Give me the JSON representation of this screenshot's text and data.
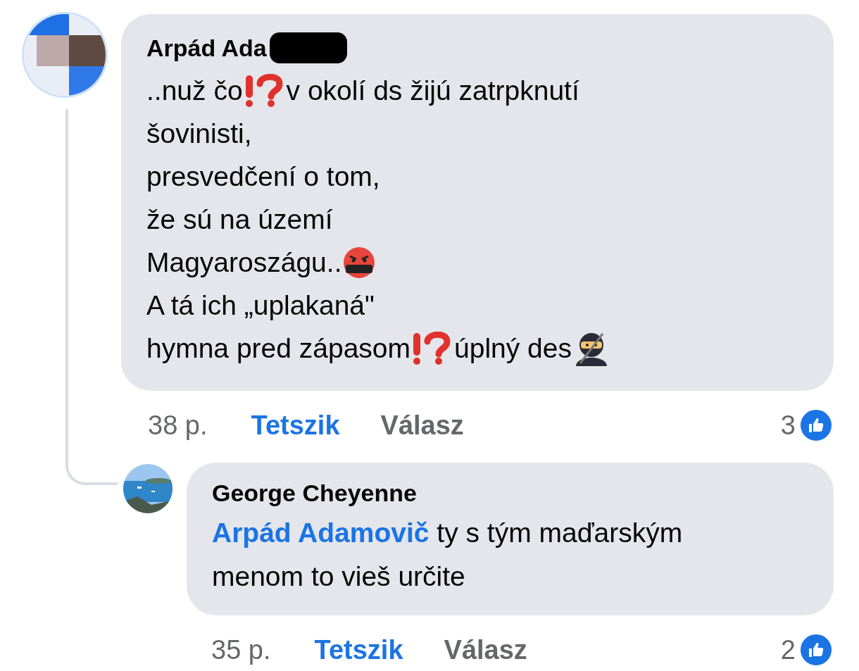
{
  "comments": [
    {
      "author": "Arpád Ada",
      "redacted": true,
      "lines": [
        [
          {
            "kind": "text",
            "text": "..nuž čo"
          },
          {
            "kind": "interrobang"
          },
          {
            "kind": "text",
            "text": "v okolí ds žijú zatrpknutí"
          }
        ],
        [
          {
            "kind": "text",
            "text": "šovinisti,"
          }
        ],
        [
          {
            "kind": "text",
            "text": "presvedčení o tom,"
          }
        ],
        [
          {
            "kind": "text",
            "text": "že sú na území"
          }
        ],
        [
          {
            "kind": "text",
            "text": "Magyaroszágu.."
          },
          {
            "kind": "swearing-face"
          }
        ],
        [
          {
            "kind": "text",
            "text": "A tá ich „uplakaná\""
          }
        ],
        [
          {
            "kind": "text",
            "text": "hymna pred zápasom"
          },
          {
            "kind": "interrobang"
          },
          {
            "kind": "text",
            "text": "úplný des"
          },
          {
            "kind": "ninja"
          }
        ]
      ],
      "time": "38 p.",
      "like_label": "Tetszik",
      "reply_label": "Válasz",
      "reaction_count": "3",
      "replies": [
        {
          "author": "George Cheyenne",
          "mention": "Arpád Adamovič",
          "text": " ty s tým maďarským menom to vieš určite",
          "time": "35 p.",
          "like_label": "Tetszik",
          "reply_label": "Válasz",
          "reaction_count": "2"
        }
      ]
    }
  ]
}
